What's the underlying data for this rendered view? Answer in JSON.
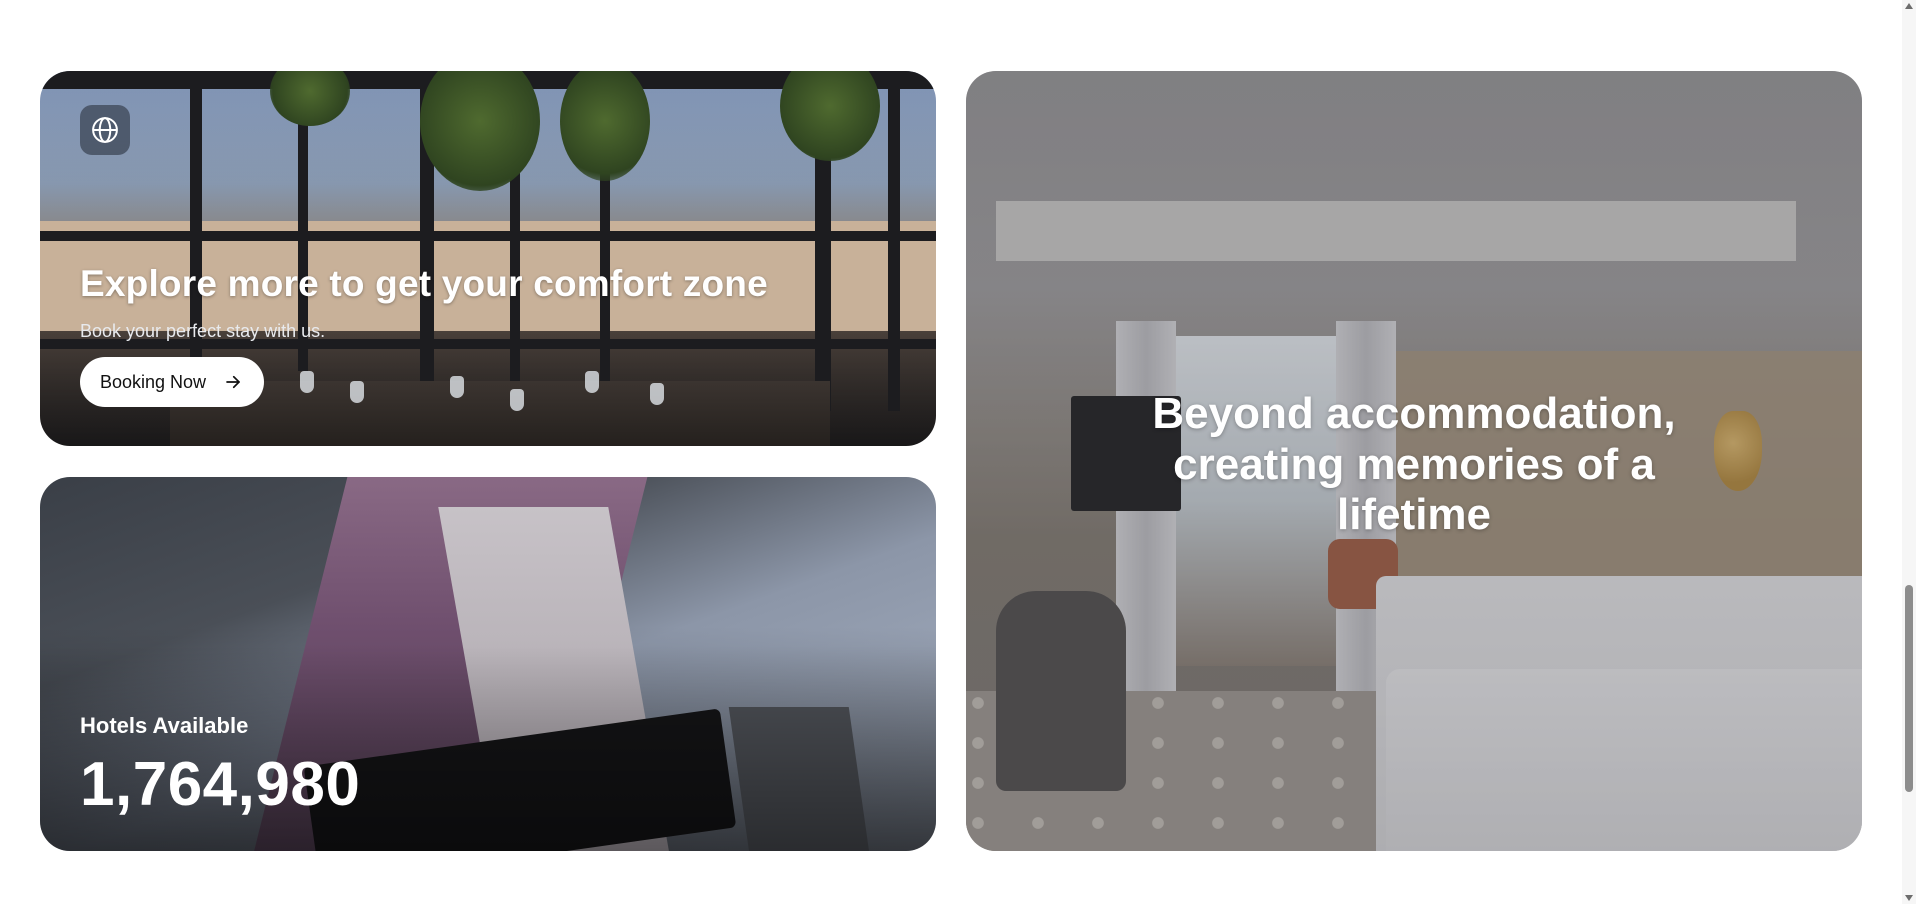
{
  "explore_card": {
    "icon": "globe-icon",
    "title": "Explore more to get your comfort zone",
    "subtitle": "Book your perfect stay with us.",
    "button_label": "Booking Now",
    "button_icon": "arrow-right-icon"
  },
  "hotels_card": {
    "label": "Hotels Available",
    "count": "1,764,980"
  },
  "room_card": {
    "headline": "Beyond accommodation, creating memories of a lifetime"
  },
  "colors": {
    "button_bg": "#ffffff",
    "text_on_image": "#ffffff",
    "page_bg": "#ffffff"
  }
}
